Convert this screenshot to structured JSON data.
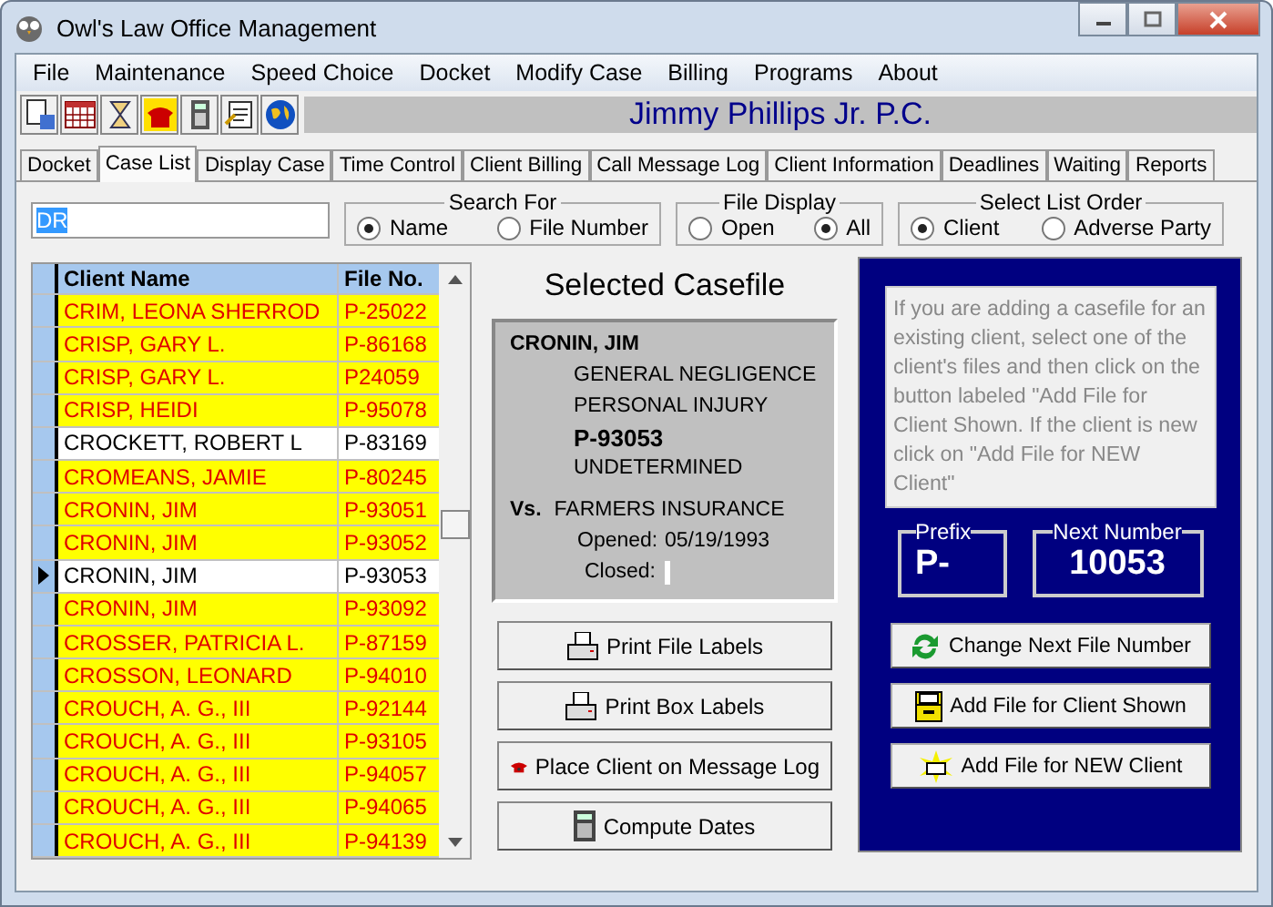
{
  "window": {
    "title": "Owl's Law Office Management"
  },
  "menu": [
    "File",
    "Maintenance",
    "Speed Choice",
    "Docket",
    "Modify Case",
    "Billing",
    "Programs",
    "About"
  ],
  "firm_name": "Jimmy Phillips Jr. P.C.",
  "tabs": [
    {
      "label": "Docket",
      "selected": false
    },
    {
      "label": "Case List",
      "selected": true
    },
    {
      "label": "Display Case",
      "selected": false
    },
    {
      "label": "Time Control",
      "selected": false
    },
    {
      "label": "Client Billing",
      "selected": false
    },
    {
      "label": "Call Message Log",
      "selected": false
    },
    {
      "label": "Client Information",
      "selected": false
    },
    {
      "label": "Deadlines",
      "selected": false
    },
    {
      "label": "Waiting",
      "selected": false
    },
    {
      "label": "Reports",
      "selected": false
    }
  ],
  "search_value": "DR",
  "search_for": {
    "title": "Search For",
    "options": [
      {
        "label": "Name",
        "selected": true
      },
      {
        "label": "File Number",
        "selected": false
      }
    ]
  },
  "file_display": {
    "title": "File Display",
    "options": [
      {
        "label": "Open",
        "selected": false
      },
      {
        "label": "All",
        "selected": true
      }
    ]
  },
  "list_order": {
    "title": "Select List Order",
    "options": [
      {
        "label": "Client",
        "selected": true
      },
      {
        "label": "Adverse Party",
        "selected": false
      }
    ]
  },
  "table": {
    "columns": [
      "Client Name",
      "File No."
    ],
    "rows": [
      {
        "name": "CRIM, LEONA SHERROD",
        "file": "P-25022",
        "highlighted": true,
        "selected": false
      },
      {
        "name": "CRISP, GARY L.",
        "file": "P-86168",
        "highlighted": true,
        "selected": false
      },
      {
        "name": "CRISP, GARY L.",
        "file": "P24059",
        "highlighted": true,
        "selected": false
      },
      {
        "name": "CRISP, HEIDI",
        "file": "P-95078",
        "highlighted": true,
        "selected": false
      },
      {
        "name": "CROCKETT, ROBERT L",
        "file": "P-83169",
        "highlighted": false,
        "selected": false
      },
      {
        "name": "CROMEANS, JAMIE",
        "file": "P-80245",
        "highlighted": true,
        "selected": false
      },
      {
        "name": "CRONIN, JIM",
        "file": "P-93051",
        "highlighted": true,
        "selected": false
      },
      {
        "name": "CRONIN, JIM",
        "file": "P-93052",
        "highlighted": true,
        "selected": false
      },
      {
        "name": "CRONIN, JIM",
        "file": "P-93053",
        "highlighted": false,
        "selected": true
      },
      {
        "name": "CRONIN, JIM",
        "file": "P-93092",
        "highlighted": true,
        "selected": false
      },
      {
        "name": "CROSSER, PATRICIA L.",
        "file": "P-87159",
        "highlighted": true,
        "selected": false
      },
      {
        "name": "CROSSON, LEONARD",
        "file": "P-94010",
        "highlighted": true,
        "selected": false
      },
      {
        "name": "CROUCH, A. G., III",
        "file": "P-92144",
        "highlighted": true,
        "selected": false
      },
      {
        "name": "CROUCH, A. G., III",
        "file": "P-93105",
        "highlighted": true,
        "selected": false
      },
      {
        "name": "CROUCH, A. G., III",
        "file": "P-94057",
        "highlighted": true,
        "selected": false
      },
      {
        "name": "CROUCH, A. G., III",
        "file": "P-94065",
        "highlighted": true,
        "selected": false
      },
      {
        "name": "CROUCH, A. G., III",
        "file": "P-94139",
        "highlighted": true,
        "selected": false
      }
    ]
  },
  "casefile": {
    "heading": "Selected Casefile",
    "client": "CRONIN, JIM",
    "case_type": "GENERAL NEGLIGENCE",
    "category": "PERSONAL INJURY",
    "file_no": "P-93053",
    "status": "UNDETERMINED",
    "vs_label": "Vs.",
    "adverse_party": "FARMERS INSURANCE",
    "opened_label": "Opened:",
    "opened": "05/19/1993",
    "closed_label": "Closed:"
  },
  "actions": [
    "Print File Labels",
    "Print Box Labels",
    "Place  Client on Message Log",
    "Compute Dates"
  ],
  "help_text": "If you are adding a casefile for an existing client, select one of the client's files and then click on the button labeled \"Add File for Client Shown.  If the client is new click on \"Add File for NEW Client\"",
  "prefix": {
    "label": "Prefix",
    "value": "P-"
  },
  "next_number": {
    "label": "Next Number",
    "value": "10053"
  },
  "file_buttons": [
    "Change Next File Number",
    "Add File for Client Shown",
    "Add File for NEW Client"
  ]
}
